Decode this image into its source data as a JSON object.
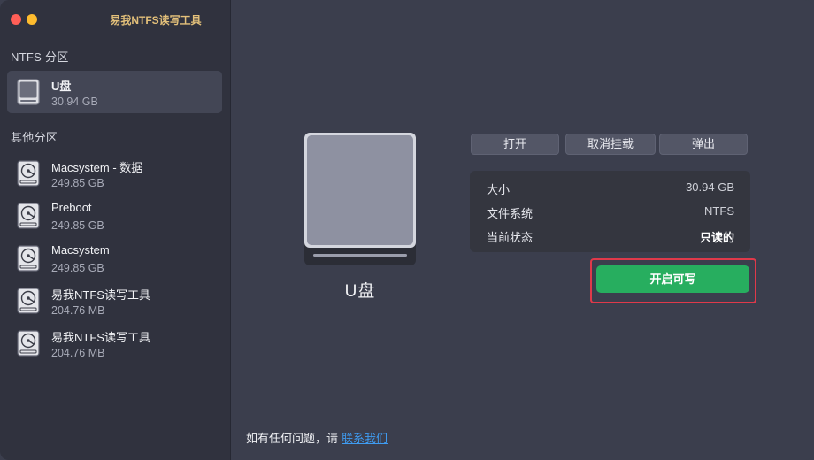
{
  "app": {
    "title": "易我NTFS读写工具"
  },
  "sidebar": {
    "ntfs_section_label": "NTFS 分区",
    "ntfs_items": [
      {
        "name": "U盘",
        "size": "30.94 GB",
        "icon": "usb-drive-icon",
        "selected": true
      }
    ],
    "other_section_label": "其他分区",
    "other_items": [
      {
        "name": "Macsystem - 数据",
        "size": "249.85 GB",
        "icon": "hard-disk-icon"
      },
      {
        "name": "Preboot",
        "size": "249.85 GB",
        "icon": "hard-disk-icon"
      },
      {
        "name": "Macsystem",
        "size": "249.85 GB",
        "icon": "hard-disk-icon"
      },
      {
        "name": "易我NTFS读写工具",
        "size": "204.76 MB",
        "icon": "hard-disk-icon"
      },
      {
        "name": "易我NTFS读写工具",
        "size": "204.76 MB",
        "icon": "hard-disk-icon"
      }
    ]
  },
  "main": {
    "drive_label": "U盘",
    "buttons": {
      "open": "打开",
      "unmount": "取消挂载",
      "eject": "弹出"
    },
    "info": [
      {
        "key": "大小",
        "value": "30.94 GB"
      },
      {
        "key": "文件系统",
        "value": "NTFS"
      },
      {
        "key": "当前状态",
        "value": "只读的"
      }
    ],
    "enable_write_label": "开启可写"
  },
  "footer": {
    "text": "如有任何问题，请",
    "link": "联系我们"
  },
  "colors": {
    "sidebar_bg": "#30323e",
    "main_bg": "#3b3e4d",
    "accent_green": "#27ae5f",
    "highlight_red": "#e0394a",
    "link_blue": "#3f9cf2",
    "title_gold": "#e3c07a"
  }
}
